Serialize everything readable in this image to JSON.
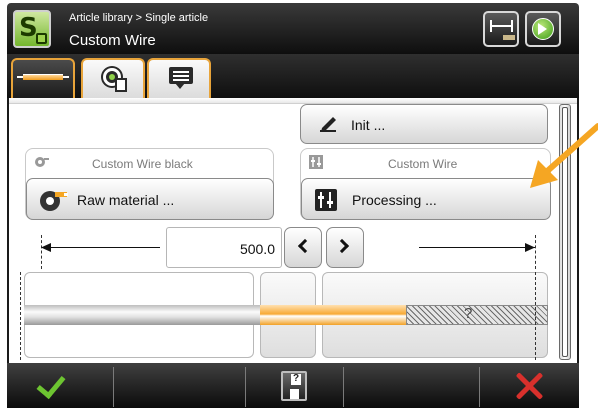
{
  "header": {
    "breadcrumb": "Article library > Single article",
    "title": "Custom Wire"
  },
  "tabs": [
    {
      "name": "wire",
      "icon": "wire-icon",
      "active": true
    },
    {
      "name": "processing",
      "icon": "gear-document-icon",
      "active": false
    },
    {
      "name": "comment",
      "icon": "comment-icon",
      "active": false
    }
  ],
  "content": {
    "init_label": "Init ...",
    "raw_material": {
      "group_title": "Custom Wire black",
      "button_label": "Raw material ...",
      "icon": "wire-spool-icon"
    },
    "processing": {
      "group_title": "Custom Wire",
      "button_label": "Processing ...",
      "icon": "processing-icon"
    },
    "length": {
      "value": "500.0"
    },
    "wire_unknown_mark": "?"
  },
  "colors": {
    "accent_orange": "#f5a623",
    "confirm_green": "#6dc431",
    "cancel_red": "#d8302c",
    "header_dark": "#1a1a1a"
  },
  "footer": {
    "confirm_icon": "check-icon",
    "save_icon": "save-disk-icon",
    "cancel_icon": "close-icon"
  }
}
